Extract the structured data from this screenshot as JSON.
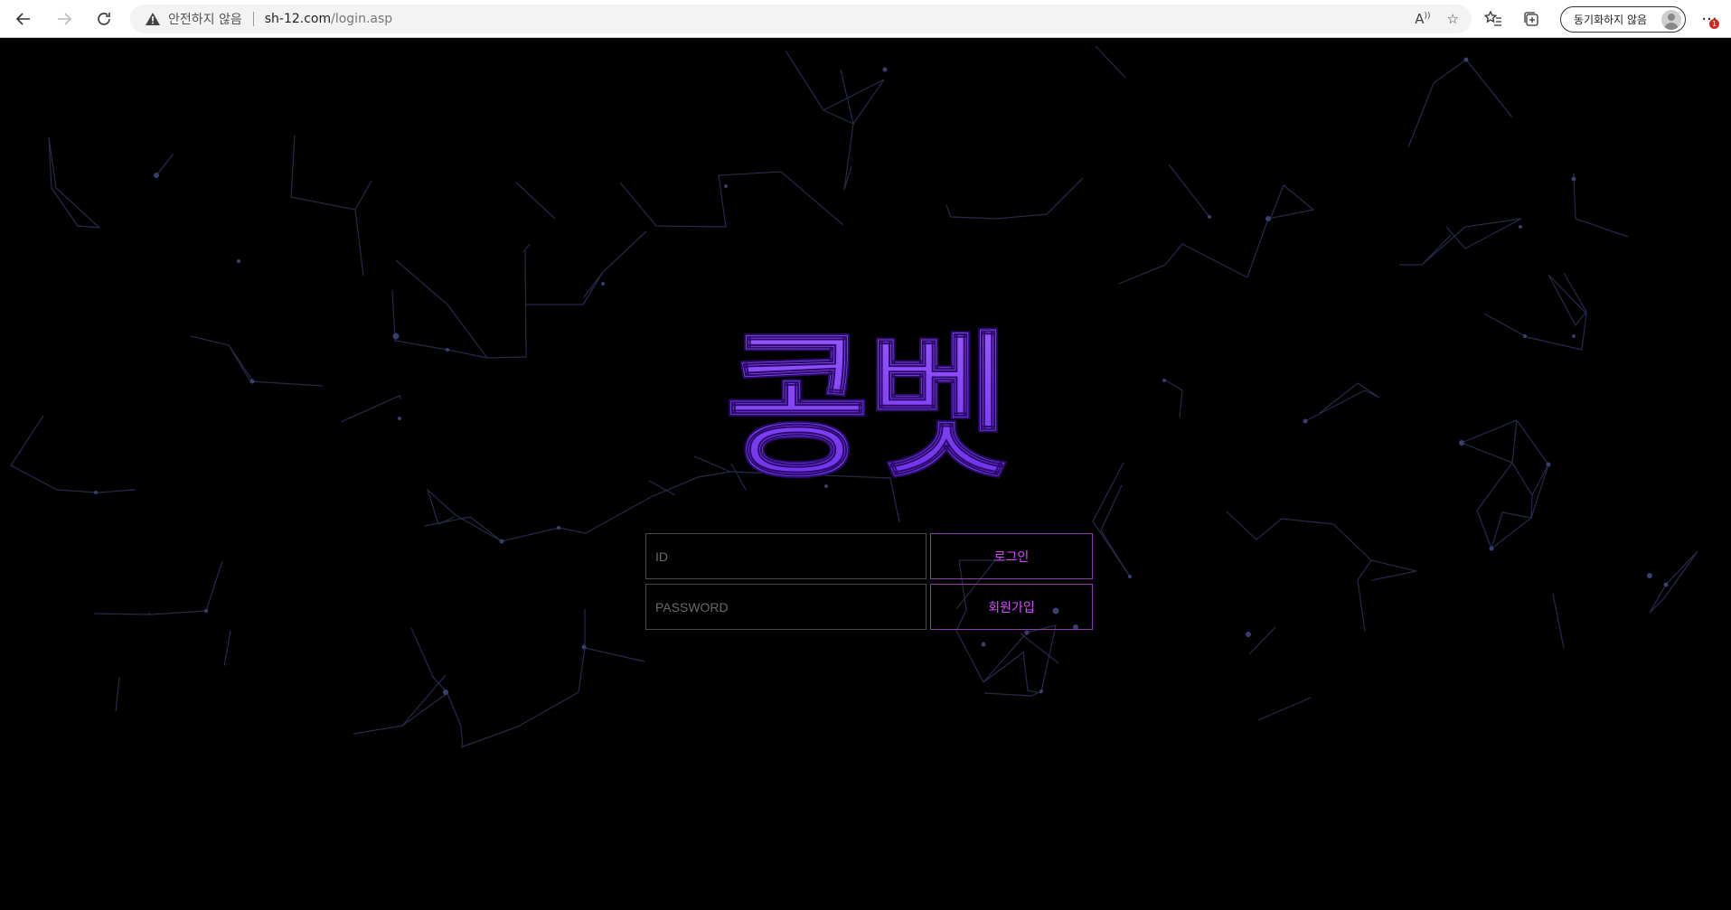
{
  "browser": {
    "security_label": "안전하지 않음",
    "url_host": "sh-12.com",
    "url_path": "/login.asp",
    "sync_label": "동기화하지 않음",
    "notification_count": "1",
    "icons": [
      "back-icon",
      "forward-icon",
      "refresh-icon",
      "warning-icon",
      "read-aloud-icon",
      "favorite-add-icon",
      "favorites-icon",
      "collections-icon",
      "more-icon"
    ]
  },
  "site": {
    "logo_text": "콩벳",
    "logo_color_top": "#9b59ff",
    "logo_color_bottom": "#6a2ee8",
    "accent_color": "#d44fff"
  },
  "login": {
    "id_placeholder": "ID",
    "password_placeholder": "PASSWORD",
    "login_label": "로그인",
    "signup_label": "회원가입"
  }
}
